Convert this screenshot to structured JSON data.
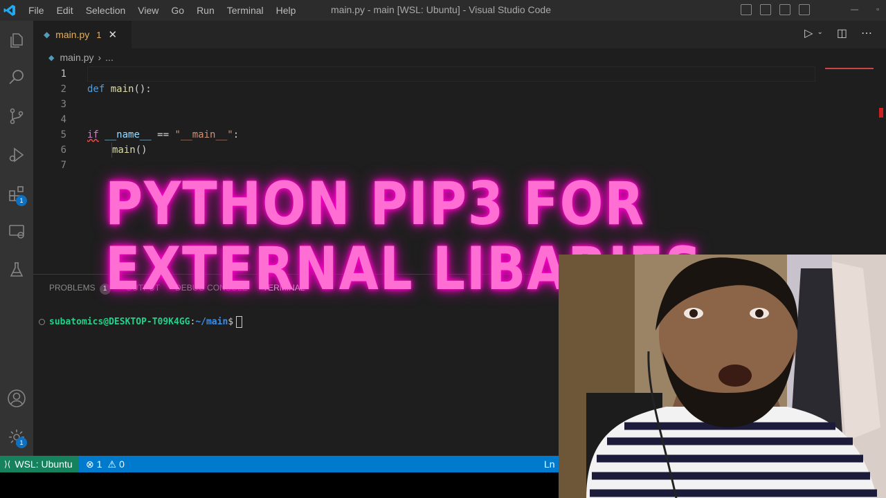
{
  "titlebar": {
    "menu": [
      "File",
      "Edit",
      "Selection",
      "View",
      "Go",
      "Run",
      "Terminal",
      "Help"
    ],
    "window_title": "main.py - main [WSL: Ubuntu] - Visual Studio Code"
  },
  "activity": {
    "extensions_badge": "1",
    "settings_badge": "1"
  },
  "tab": {
    "filename": "main.py",
    "problem_count": "1",
    "close": "✕"
  },
  "breadcrumb": {
    "file": "main.py",
    "sep": "›",
    "rest": "..."
  },
  "editor": {
    "line_numbers": [
      "1",
      "2",
      "3",
      "4",
      "5",
      "6",
      "7"
    ],
    "line2": {
      "kw": "def",
      "fn": "main",
      "rest": "():"
    },
    "line5": {
      "kw": "if",
      "var": "__name__",
      "op": " == ",
      "str": "\"__main__\"",
      "rest": ":"
    },
    "line6": {
      "fn": "main",
      "rest": "()"
    }
  },
  "panel": {
    "tabs": [
      "PROBLEMS",
      "OUTPUT",
      "DEBUG CONSOLE",
      "TERMINAL"
    ],
    "problems_count": "1",
    "terminal": {
      "user": "subatomics@DESKTOP-T09K4GG",
      "colon": ":",
      "path": "~/main",
      "prompt": "$"
    }
  },
  "statusbar": {
    "remote": "WSL: Ubuntu",
    "errors": "1",
    "warnings": "0",
    "position": "Ln"
  },
  "overlay": {
    "line1": "PYTHON PIP3 FOR",
    "line2": "EXTERNAL LIBARIES"
  },
  "colors": {
    "accent": "#007acc",
    "remote": "#16825d",
    "overlay_text": "#ff6ed3"
  }
}
